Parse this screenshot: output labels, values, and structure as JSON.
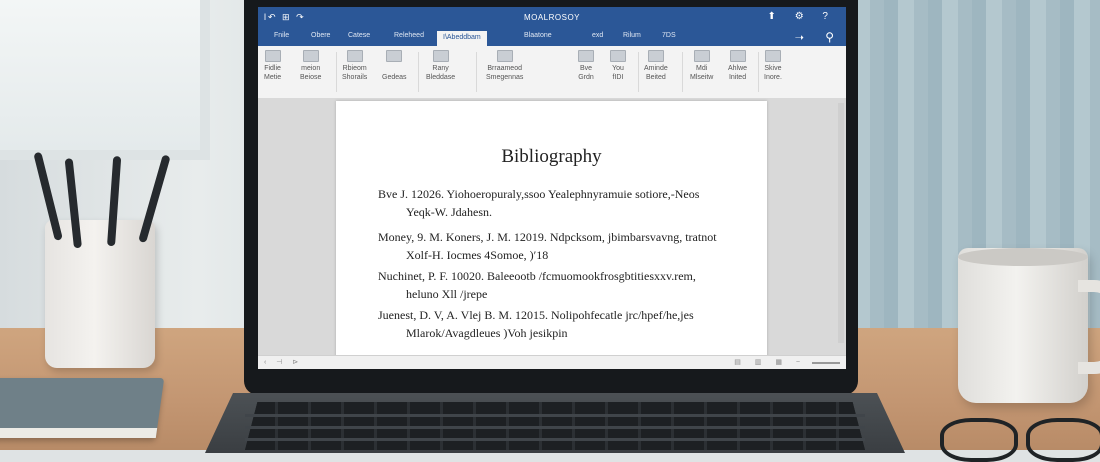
{
  "title_bar": {
    "doc_name": "MOALROSOY",
    "quick_access": "Ɩ↶ ⊞ ↷",
    "right_icons": "⬆ ⚙ ?"
  },
  "tabs": [
    "Fnile",
    "Obere",
    "Catese",
    "Releheed",
    "I\\Abeddbam",
    "Blaatone",
    "exd",
    "Rilum",
    "7DS"
  ],
  "active_tab_index": 4,
  "ribbon_groups": [
    {
      "line1": "Fidlie",
      "line2": "Metie"
    },
    {
      "line1": "meion",
      "line2": "Beiose"
    },
    {
      "line1": "Rbieom",
      "line2": "Shorails"
    },
    {
      "line1": "",
      "line2": "Gedeas"
    },
    {
      "line1": "Rany",
      "line2": "Bleddase"
    },
    {
      "line1": "Brraameod",
      "line2": "Smegennas"
    },
    {
      "line1": "Bve",
      "line2": "Grdn"
    },
    {
      "line1": "You",
      "line2": "fIDI"
    },
    {
      "line1": "Aminde",
      "line2": "Beited"
    },
    {
      "line1": "Mdi",
      "line2": "Mlseitw"
    },
    {
      "line1": "Ahlwe",
      "line2": "Inited"
    },
    {
      "line1": "Skive",
      "line2": "Inore."
    }
  ],
  "document": {
    "heading": "Bibliography",
    "entries": [
      {
        "line1": "Bve  J. 12026.  Yiohoeropuraly,ssoo Yealephnyramuie sotiore,-Neos",
        "line2": "Yeqk-W. Jdahesn."
      },
      {
        "line1": "Money, 9.  M.  Koners,  J.  M.  12019.  Ndpcksom, jbimbarsvavng, tratnot",
        "line2": "Xolf-H. Iocmes  4Somoe,  )′18"
      },
      {
        "line1": "Nuchinet,  P.  F. 10020. Baleeootb /fcmuomookfrosgbtitiesxxv.rem,",
        "line2": "heluno Xll /jrepe"
      },
      {
        "line1": "Juenest,  D. V,  A. Vlej  B. M. 12015.  Nolipohfecatle jrc/hpef/he,jes",
        "line2": "Mlarok/Avagdleues  )Voh jesikpin"
      }
    ]
  },
  "status_bar": {
    "left": "‹ ⊣ ⊳",
    "right": "▤ ▥ ▦ −"
  },
  "colors": {
    "title_bar": "#2b5797",
    "page": "#ffffff",
    "doc_background": "#d9d9d9"
  }
}
